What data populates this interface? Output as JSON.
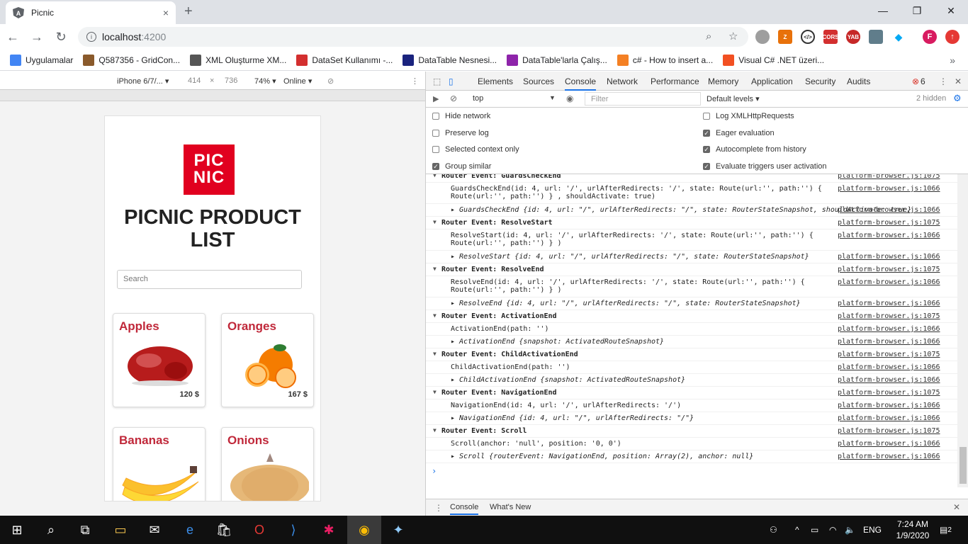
{
  "browser": {
    "tab_title": "Picnic",
    "url_host": "localhost",
    "url_port": ":4200",
    "new_tab": "+",
    "close_tab": "×",
    "win_min": "—",
    "win_max": "❐",
    "win_close": "✕"
  },
  "bookmarks": [
    {
      "label": "Uygulamalar",
      "color": "#4285f4"
    },
    {
      "label": "Q587356 - GridCon...",
      "color": "#8a5a2b"
    },
    {
      "label": "XML Oluşturme XM...",
      "color": "#555555"
    },
    {
      "label": "DataSet Kullanımı -...",
      "color": "#d32f2f"
    },
    {
      "label": "DataTable Nesnesi...",
      "color": "#1a237e"
    },
    {
      "label": "DataTable'larla Çalış...",
      "color": "#8e24aa"
    },
    {
      "label": "c# - How to insert a...",
      "color": "#f48024"
    },
    {
      "label": "Visual C# .NET üzeri...",
      "color": "#f25022"
    }
  ],
  "bookmarks_more": "»",
  "device_toolbar": {
    "device": "iPhone 6/7/... ▾",
    "width": "414",
    "times": "×",
    "height": "736",
    "zoom": "74% ▾",
    "network": "Online ▾"
  },
  "page": {
    "logo_line1": "PIC",
    "logo_line2": "NIC",
    "title": "PICNIC PRODUCT LIST",
    "search_placeholder": "Search",
    "products": [
      {
        "name": "Apples",
        "price": "120 $"
      },
      {
        "name": "Oranges",
        "price": "167 $"
      },
      {
        "name": "Bananas",
        "price": ""
      },
      {
        "name": "Onions",
        "price": ""
      }
    ]
  },
  "devtools": {
    "tabs": [
      "Elements",
      "Sources",
      "Console",
      "Network",
      "Performance",
      "Memory",
      "Application",
      "Security",
      "Audits"
    ],
    "error_count": "6",
    "context": "top",
    "filter_placeholder": "Filter",
    "levels": "Default levels ▾",
    "hidden": "2 hidden",
    "settings_left": [
      {
        "label": "Hide network",
        "checked": false
      },
      {
        "label": "Preserve log",
        "checked": false
      },
      {
        "label": "Selected context only",
        "checked": false
      },
      {
        "label": "Group similar",
        "checked": true
      }
    ],
    "settings_right": [
      {
        "label": "Log XMLHttpRequests",
        "checked": false
      },
      {
        "label": "Eager evaluation",
        "checked": true
      },
      {
        "label": "Autocomplete from history",
        "checked": true
      },
      {
        "label": "Evaluate triggers user activation",
        "checked": true
      }
    ],
    "drawer_tabs": [
      "Console",
      "What's New"
    ],
    "console_lines": [
      {
        "kind": "group",
        "text": "Router Event: GuardsCheckEnd",
        "src": "platform-browser.js:1075"
      },
      {
        "kind": "plain",
        "text": "GuardsCheckEnd(id: 4, url: '/', urlAfterRedirects: '/', state: Route(url:'', path:'') {\nRoute(url:'', path:'') } , shouldActivate: true)",
        "src": "platform-browser.js:1066"
      },
      {
        "kind": "obj",
        "text": "▸ GuardsCheckEnd {id: 4, url: \"/\", urlAfterRedirects: \"/\", state: RouterStateSnapshot, shouldActivate: true}",
        "src": "platform-browser.js:1066"
      },
      {
        "kind": "group",
        "text": "Router Event: ResolveStart",
        "src": "platform-browser.js:1075"
      },
      {
        "kind": "plain",
        "text": "ResolveStart(id: 4, url: '/', urlAfterRedirects: '/', state: Route(url:'', path:'') {\nRoute(url:'', path:'') } )",
        "src": "platform-browser.js:1066"
      },
      {
        "kind": "obj",
        "text": "▸ ResolveStart {id: 4, url: \"/\", urlAfterRedirects: \"/\", state: RouterStateSnapshot}",
        "src": "platform-browser.js:1066"
      },
      {
        "kind": "group",
        "text": "Router Event: ResolveEnd",
        "src": "platform-browser.js:1075"
      },
      {
        "kind": "plain",
        "text": "ResolveEnd(id: 4, url: '/', urlAfterRedirects: '/', state: Route(url:'', path:'') {\nRoute(url:'', path:'') } )",
        "src": "platform-browser.js:1066"
      },
      {
        "kind": "obj",
        "text": "▸ ResolveEnd {id: 4, url: \"/\", urlAfterRedirects: \"/\", state: RouterStateSnapshot}",
        "src": "platform-browser.js:1066"
      },
      {
        "kind": "group",
        "text": "Router Event: ActivationEnd",
        "src": "platform-browser.js:1075"
      },
      {
        "kind": "plain",
        "text": "ActivationEnd(path: '')",
        "src": "platform-browser.js:1066"
      },
      {
        "kind": "obj",
        "text": "▸ ActivationEnd {snapshot: ActivatedRouteSnapshot}",
        "src": "platform-browser.js:1066"
      },
      {
        "kind": "group",
        "text": "Router Event: ChildActivationEnd",
        "src": "platform-browser.js:1075"
      },
      {
        "kind": "plain",
        "text": "ChildActivationEnd(path: '')",
        "src": "platform-browser.js:1066"
      },
      {
        "kind": "obj",
        "text": "▸ ChildActivationEnd {snapshot: ActivatedRouteSnapshot}",
        "src": "platform-browser.js:1066"
      },
      {
        "kind": "group",
        "text": "Router Event: NavigationEnd",
        "src": "platform-browser.js:1075"
      },
      {
        "kind": "plain",
        "text": "NavigationEnd(id: 4, url: '/', urlAfterRedirects: '/')",
        "src": "platform-browser.js:1066"
      },
      {
        "kind": "obj",
        "text": "▸ NavigationEnd {id: 4, url: \"/\", urlAfterRedirects: \"/\"}",
        "src": "platform-browser.js:1066"
      },
      {
        "kind": "group",
        "text": "Router Event: Scroll",
        "src": "platform-browser.js:1075"
      },
      {
        "kind": "plain",
        "text": "Scroll(anchor: 'null', position: '0, 0')",
        "src": "platform-browser.js:1066"
      },
      {
        "kind": "obj",
        "text": "▸ Scroll {routerEvent: NavigationEnd, position: Array(2), anchor: null}",
        "src": "platform-browser.js:1066"
      }
    ],
    "prompt": "›"
  },
  "taskbar": {
    "language": "ENG",
    "time": "7:24 AM",
    "date": "1/9/2020",
    "notifications": "2"
  }
}
